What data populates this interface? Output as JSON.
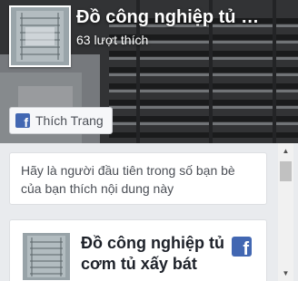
{
  "header": {
    "page_title": "Đồ công nghiệp tủ …",
    "like_count": "63 lượt thích",
    "like_button_label": "Thích Trang"
  },
  "feed": {
    "friends_prompt": "Hãy là người đầu tiên trong số bạn bè của bạn thích nội dung này",
    "post": {
      "title": "Đồ công nghiệp tủ cơm tủ xấy bát"
    }
  },
  "icons": {
    "like_button_icon": "facebook-icon",
    "post_brand_icon": "facebook-icon",
    "scroll_up": "arrow-up-icon",
    "scroll_down": "arrow-down-icon"
  },
  "colors": {
    "facebook_blue": "#4267b2",
    "feed_background": "#e9ebee",
    "text_primary": "#1d2129",
    "text_secondary": "#4b4f56"
  }
}
